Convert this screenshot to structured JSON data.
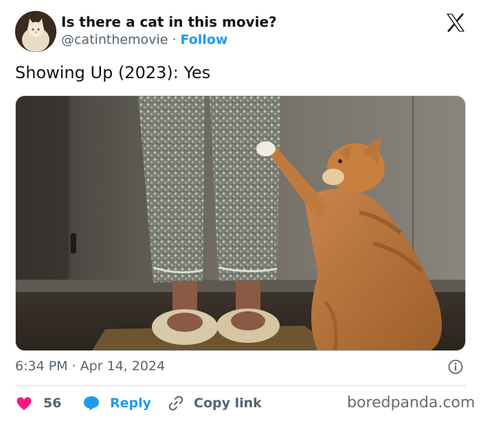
{
  "author": {
    "display_name": "Is there a cat in this movie?",
    "handle": "@catinthemovie",
    "separator": "·",
    "follow_label": "Follow"
  },
  "logo_icon": "x-logo-icon",
  "tweet": {
    "text": "Showing Up (2023): Yes",
    "timestamp": "6:34 PM · Apr 14, 2024"
  },
  "actions": {
    "like_count": "56",
    "reply_label": "Reply",
    "copy_link_label": "Copy link"
  },
  "watermark": "boredpanda.com",
  "colors": {
    "accent": "#1d9bf0",
    "like": "#f91880",
    "text_secondary": "#536471"
  }
}
